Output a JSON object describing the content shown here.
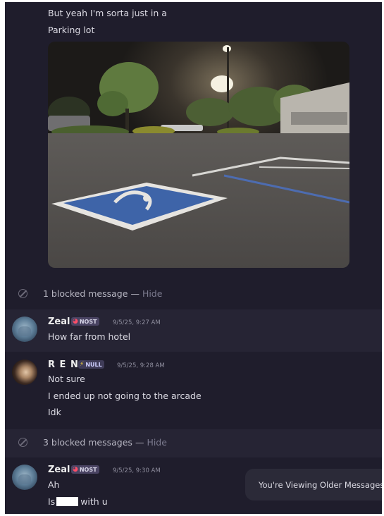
{
  "messages_top": {
    "line1": "But yeah I'm sorta just in a",
    "line2": "Parking lot"
  },
  "blocked_1": {
    "text": "1 blocked message",
    "dash": "—",
    "hide": "Hide"
  },
  "msg_zeal_1": {
    "author": "Zeal",
    "tag": "NOST",
    "tag_icon": "bean-icon",
    "time": "9/5/25, 9:27 AM",
    "text": "How far from hotel"
  },
  "msg_ren": {
    "author": "R E N",
    "tag": "NULL",
    "tag_icon": "lightning-icon",
    "time": "9/5/25, 9:28 AM",
    "lines": [
      "Not sure",
      "I ended up not going to the arcade",
      "Idk"
    ]
  },
  "blocked_2": {
    "text": "3 blocked messages",
    "dash": "—",
    "hide": "Hide"
  },
  "msg_zeal_2": {
    "author": "Zeal",
    "tag": "NOST",
    "time": "9/5/25, 9:30 AM",
    "line1": "Ah",
    "line2_before": "Is",
    "line2_after": "with u"
  },
  "toast": {
    "text": "You're Viewing Older Messages"
  },
  "colors": {
    "background": "#1f1d2c",
    "nost_icon": "#ff4e68",
    "null_icon": "#f2d23a"
  }
}
